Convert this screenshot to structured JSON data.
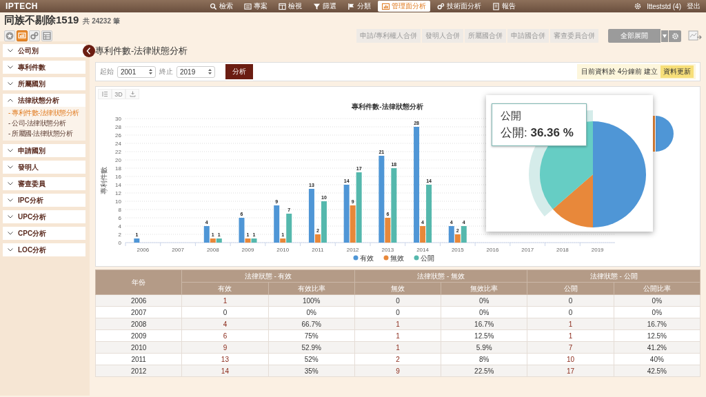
{
  "top_nav": {
    "logo": "IPTECH",
    "items": [
      {
        "label": "檢索",
        "selected": false
      },
      {
        "label": "專案",
        "selected": false
      },
      {
        "label": "檢視",
        "selected": false
      },
      {
        "label": "篩選",
        "selected": false
      },
      {
        "label": "分類",
        "selected": false
      },
      {
        "label": "管理面分析",
        "selected": true
      },
      {
        "label": "技術面分析",
        "selected": false
      },
      {
        "label": "報告",
        "selected": false
      }
    ],
    "user": "ltteststd (4)",
    "logout": "登出"
  },
  "header": {
    "title": "同族不剔除1519",
    "count": "共 24232 筆",
    "view_icons": [
      {
        "selected": false
      },
      {
        "selected": true
      },
      {
        "selected": false
      },
      {
        "selected": false
      }
    ],
    "merge_buttons": [
      "申請/專利權人合併",
      "發明人合併",
      "所屬國合併",
      "申請國合併",
      "審查委員合併"
    ],
    "expand_dropdown": "全部展開"
  },
  "sidebar": {
    "items": [
      {
        "label": "公司別",
        "expanded": false
      },
      {
        "label": "專利件數",
        "expanded": false
      },
      {
        "label": "所屬國別",
        "expanded": false
      },
      {
        "label": "法律狀態分析",
        "expanded": true,
        "children": [
          {
            "label": "- 專利件數-法律狀態分析",
            "selected": true
          },
          {
            "label": "- 公司-法律狀態分析",
            "selected": false
          },
          {
            "label": "- 所屬國-法律狀態分析",
            "selected": false
          }
        ]
      },
      {
        "label": "申請國別",
        "expanded": false
      },
      {
        "label": "發明人",
        "expanded": false
      },
      {
        "label": "審查委員",
        "expanded": false
      },
      {
        "label": "IPC分析",
        "expanded": false
      },
      {
        "label": "UPC分析",
        "expanded": false
      },
      {
        "label": "CPC分析",
        "expanded": false
      },
      {
        "label": "LOC分析",
        "expanded": false
      }
    ]
  },
  "page_title": "專利件數-法律狀態分析",
  "filter": {
    "start_label": "起始",
    "start_value": "2001",
    "end_label": "終止",
    "end_value": "2019",
    "analyze_button": "分析",
    "status": "目前資料於 4分鐘前 建立",
    "refresh_button": "資料更新"
  },
  "chart": {
    "toolbar_3d": "3D",
    "chart_data": {
      "type": "bar",
      "title": "專利件數-法律狀態分析",
      "ylabel": "專利件數",
      "categories": [
        "2006",
        "2007",
        "2008",
        "2009",
        "2010",
        "2011",
        "2012",
        "2013",
        "2014",
        "2015",
        "2016",
        "2017",
        "2018",
        "2019"
      ],
      "series": [
        {
          "name": "有效",
          "color": "#4f96d6",
          "values": [
            1,
            0,
            4,
            6,
            9,
            13,
            14,
            21,
            28,
            4,
            null,
            null,
            null,
            null
          ]
        },
        {
          "name": "無效",
          "color": "#e8883a",
          "values": [
            0,
            0,
            1,
            1,
            1,
            2,
            9,
            6,
            4,
            2,
            null,
            null,
            null,
            null
          ]
        },
        {
          "name": "公開",
          "color": "#55b8ad",
          "values": [
            0,
            0,
            1,
            1,
            7,
            10,
            17,
            18,
            14,
            4,
            null,
            null,
            null,
            null
          ]
        }
      ],
      "ylim": [
        0,
        30
      ],
      "yticks": [
        0,
        2,
        4,
        6,
        8,
        10,
        12,
        14,
        16,
        18,
        20,
        22,
        24,
        26,
        28,
        30
      ],
      "grid": true,
      "legend": "bottom",
      "value_labels": [
        [
          "1",
          null,
          "4",
          "6",
          "9",
          "13",
          "14",
          "21",
          "28",
          "4",
          null,
          null,
          null,
          null
        ],
        [
          null,
          null,
          "1",
          "1",
          "1",
          "2",
          "9",
          "6",
          "4",
          "2",
          null,
          null,
          null,
          null
        ],
        [
          null,
          null,
          "1",
          "1",
          "7",
          "10",
          "17",
          "18",
          "14",
          "4",
          null,
          null,
          null,
          null
        ]
      ]
    },
    "tooltip": {
      "title": "公開",
      "text": "公開: **36.36 %**"
    }
  },
  "table": {
    "year_header": "年份",
    "groups": [
      {
        "title": "法律狀態 - 有效",
        "columns": [
          "有效",
          "有效比率"
        ]
      },
      {
        "title": "法律狀態 - 無效",
        "columns": [
          "無效",
          "無效比率"
        ]
      },
      {
        "title": "法律狀態 - 公開",
        "columns": [
          "公開",
          "公開比率"
        ]
      }
    ],
    "rows": [
      {
        "year": "2006",
        "cells": [
          {
            "text": "1",
            "link": true
          },
          {
            "text": "100%"
          },
          {
            "text": "0",
            "link": false
          },
          {
            "text": "0%"
          },
          {
            "text": "0",
            "link": false
          },
          {
            "text": "0%"
          }
        ]
      },
      {
        "year": "2007",
        "cells": [
          {
            "text": "0",
            "link": false
          },
          {
            "text": "0%"
          },
          {
            "text": "0",
            "link": false
          },
          {
            "text": "0%"
          },
          {
            "text": "0",
            "link": false
          },
          {
            "text": "0%"
          }
        ]
      },
      {
        "year": "2008",
        "cells": [
          {
            "text": "4",
            "link": true
          },
          {
            "text": "66.7%"
          },
          {
            "text": "1",
            "link": true
          },
          {
            "text": "16.7%"
          },
          {
            "text": "1",
            "link": true
          },
          {
            "text": "16.7%"
          }
        ]
      },
      {
        "year": "2009",
        "cells": [
          {
            "text": "6",
            "link": true
          },
          {
            "text": "75%"
          },
          {
            "text": "1",
            "link": true
          },
          {
            "text": "12.5%"
          },
          {
            "text": "1",
            "link": true
          },
          {
            "text": "12.5%"
          }
        ]
      },
      {
        "year": "2010",
        "cells": [
          {
            "text": "9",
            "link": true
          },
          {
            "text": "52.9%"
          },
          {
            "text": "1",
            "link": true
          },
          {
            "text": "5.9%"
          },
          {
            "text": "7",
            "link": true
          },
          {
            "text": "41.2%"
          }
        ]
      },
      {
        "year": "2011",
        "cells": [
          {
            "text": "13",
            "link": true
          },
          {
            "text": "52%"
          },
          {
            "text": "2",
            "link": true
          },
          {
            "text": "8%"
          },
          {
            "text": "10",
            "link": true
          },
          {
            "text": "40%"
          }
        ]
      },
      {
        "year": "2012",
        "cells": [
          {
            "text": "14",
            "link": true
          },
          {
            "text": "35%"
          },
          {
            "text": "9",
            "link": true
          },
          {
            "text": "22.5%"
          },
          {
            "text": "17",
            "link": true
          },
          {
            "text": "42.5%"
          }
        ]
      }
    ]
  }
}
